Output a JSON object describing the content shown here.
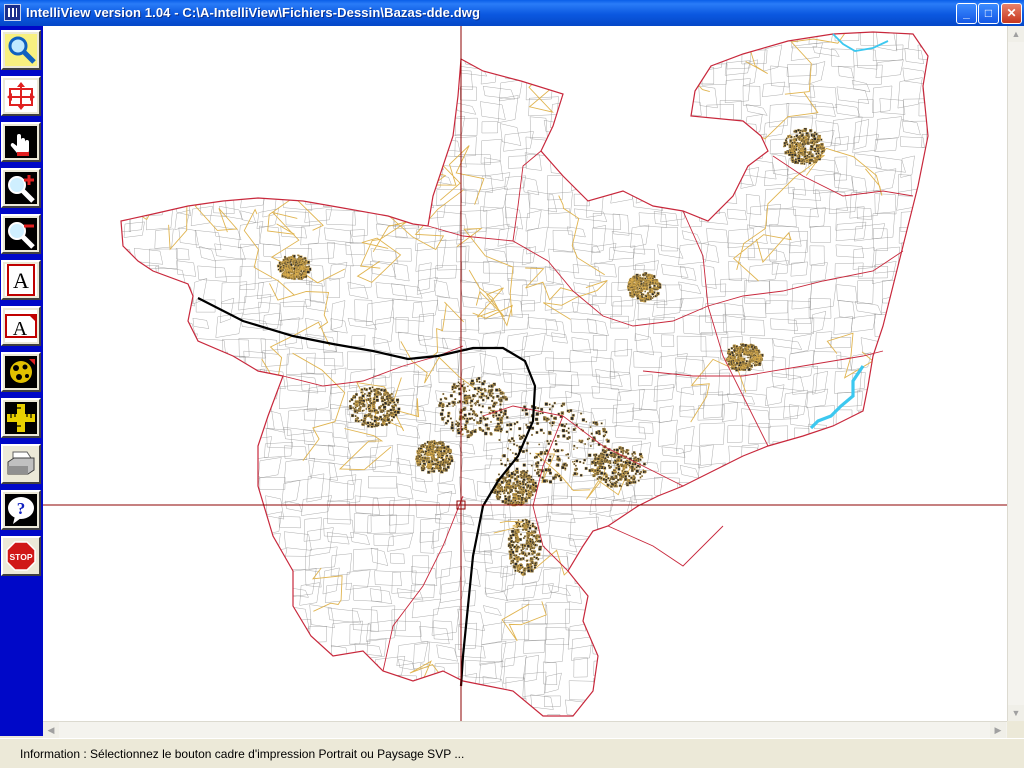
{
  "window": {
    "title": "IntelliView version 1.04 - C:\\A-IntelliView\\Fichiers-Dessin\\Bazas-dde.dwg",
    "controls": {
      "minimize": "_",
      "maximize": "□",
      "close": "✕"
    }
  },
  "toolbar": {
    "tools": [
      {
        "name": "zoom-extents",
        "icon": "magnifier-icon"
      },
      {
        "name": "zoom-window",
        "icon": "move-arrows-icon"
      },
      {
        "name": "pan",
        "icon": "hand-icon"
      },
      {
        "name": "zoom-in",
        "icon": "zoom-in-icon"
      },
      {
        "name": "zoom-out",
        "icon": "zoom-out-icon"
      },
      {
        "name": "text-portrait",
        "icon": "text-a-icon"
      },
      {
        "name": "text-landscape",
        "icon": "text-a-icon"
      },
      {
        "name": "layers",
        "icon": "layers-icon"
      },
      {
        "name": "measure",
        "icon": "ruler-icon"
      },
      {
        "name": "print",
        "icon": "printer-icon"
      },
      {
        "name": "help",
        "icon": "help-icon"
      },
      {
        "name": "quit",
        "icon": "stop-icon",
        "label": "STOP"
      }
    ],
    "colors": {
      "background": "#0008c8"
    }
  },
  "map": {
    "drawing": "Bazas-dde.dwg",
    "colors": {
      "boundary": "#c8283c",
      "roads": "#e0b450",
      "parcels": "#8a8a8a",
      "railway": "#000000",
      "water": "#3cc8f0",
      "crosshair": "#8c0000"
    }
  },
  "status": {
    "text": "Information : Sélectionnez le bouton cadre d'impression Portrait ou Paysage SVP ..."
  }
}
